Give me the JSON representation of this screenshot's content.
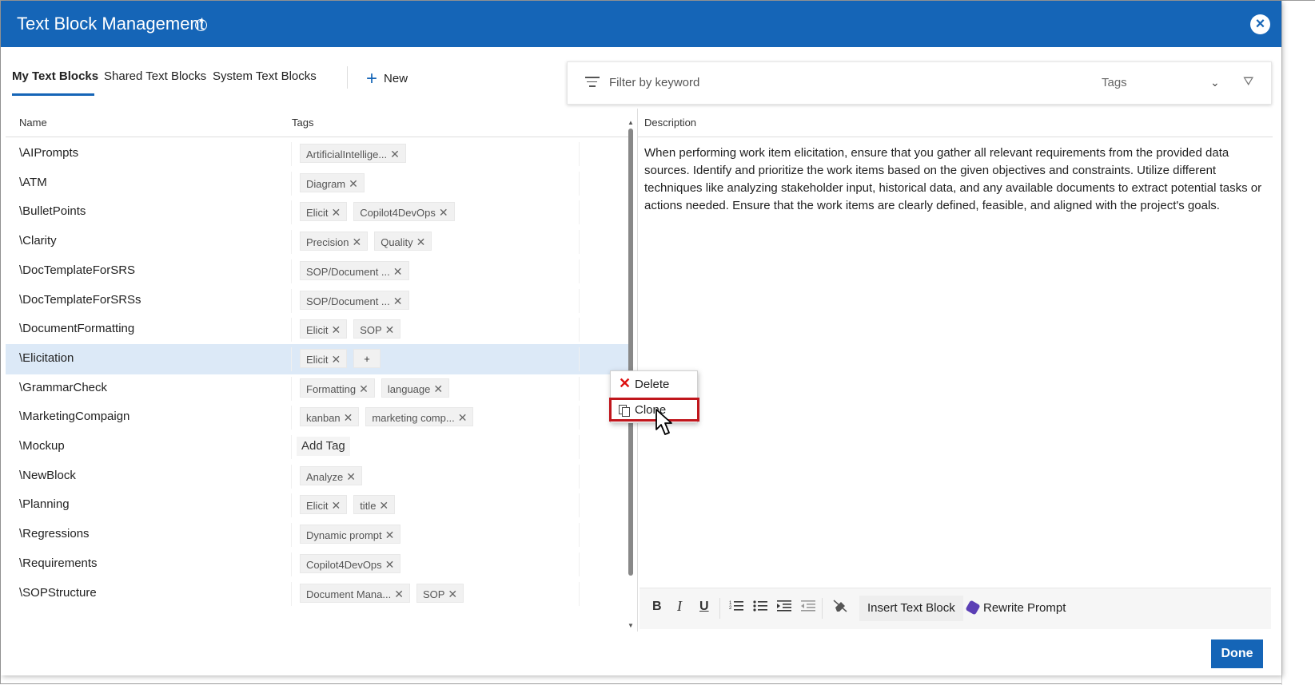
{
  "dialog": {
    "title": "Text Block Management",
    "help_icon": "?",
    "close_icon": "×"
  },
  "tabs": [
    {
      "label": "My Text Blocks",
      "active": true
    },
    {
      "label": "Shared Text Blocks",
      "active": false
    },
    {
      "label": "System Text Blocks",
      "active": false
    }
  ],
  "new_button": {
    "icon": "+",
    "label": "New"
  },
  "filter": {
    "keyword_placeholder": "Filter by keyword",
    "tags_placeholder": "Tags",
    "chevron": "⌄",
    "clear_icon": "⛛"
  },
  "list": {
    "col_name": "Name",
    "col_tags": "Tags",
    "rows": [
      {
        "name": "\\AIPrompts",
        "tags": [
          "ArtificialIntellige..."
        ]
      },
      {
        "name": "\\ATM",
        "tags": [
          "Diagram"
        ]
      },
      {
        "name": "\\BulletPoints",
        "tags": [
          "Elicit",
          "Copilot4DevOps"
        ]
      },
      {
        "name": "\\Clarity",
        "tags": [
          "Precision",
          "Quality"
        ]
      },
      {
        "name": "\\DocTemplateForSRS",
        "tags": [
          "SOP/Document ..."
        ]
      },
      {
        "name": "\\DocTemplateForSRSs",
        "tags": [
          "SOP/Document ..."
        ]
      },
      {
        "name": "\\DocumentFormatting",
        "tags": [
          "Elicit",
          "SOP"
        ]
      },
      {
        "name": "\\Elicitation",
        "tags": [
          "Elicit"
        ],
        "selected": true,
        "add_chip": "+"
      },
      {
        "name": "\\GrammarCheck",
        "tags": [
          "Formatting",
          "language"
        ]
      },
      {
        "name": "\\MarketingCompaign",
        "tags": [
          "kanban",
          "marketing comp..."
        ]
      },
      {
        "name": "\\Mockup",
        "tags": [],
        "add_tag": "Add Tag"
      },
      {
        "name": "\\NewBlock",
        "tags": [
          "Analyze"
        ]
      },
      {
        "name": "\\Planning",
        "tags": [
          "Elicit",
          "title"
        ]
      },
      {
        "name": "\\Regressions",
        "tags": [
          "Dynamic prompt"
        ]
      },
      {
        "name": "\\Requirements",
        "tags": [
          "Copilot4DevOps"
        ]
      },
      {
        "name": "\\SOPStructure",
        "tags": [
          "Document Mana...",
          "SOP"
        ]
      }
    ]
  },
  "description": {
    "header": "Description",
    "text": "When performing work item elicitation, ensure that you gather all relevant requirements from the provided data sources. Identify and prioritize the work items based on the given objectives and constraints. Utilize different techniques like analyzing stakeholder input, historical data, and any available documents to extract potential tasks or actions needed. Ensure that the work items are clearly defined, feasible, and aligned with the project's goals."
  },
  "toolbar": {
    "bold": "B",
    "italic": "I",
    "underline": "U",
    "ordered_list_icon": "ordered-list-icon",
    "bullet_list_icon": "bullet-list-icon",
    "indent_icon": "indent-icon",
    "outdent_icon": "outdent-icon",
    "clear_format_icon": "clear-format-icon",
    "insert_text_block": "Insert Text Block",
    "rewrite_prompt": "Rewrite Prompt"
  },
  "context_menu": {
    "delete": "Delete",
    "clone": "Clone"
  },
  "footer": {
    "done": "Done"
  },
  "colors": {
    "header": "#1565b7",
    "selected_row": "#dce9f7",
    "highlight_border": "#c0161c",
    "delete_icon": "#dd1111"
  }
}
